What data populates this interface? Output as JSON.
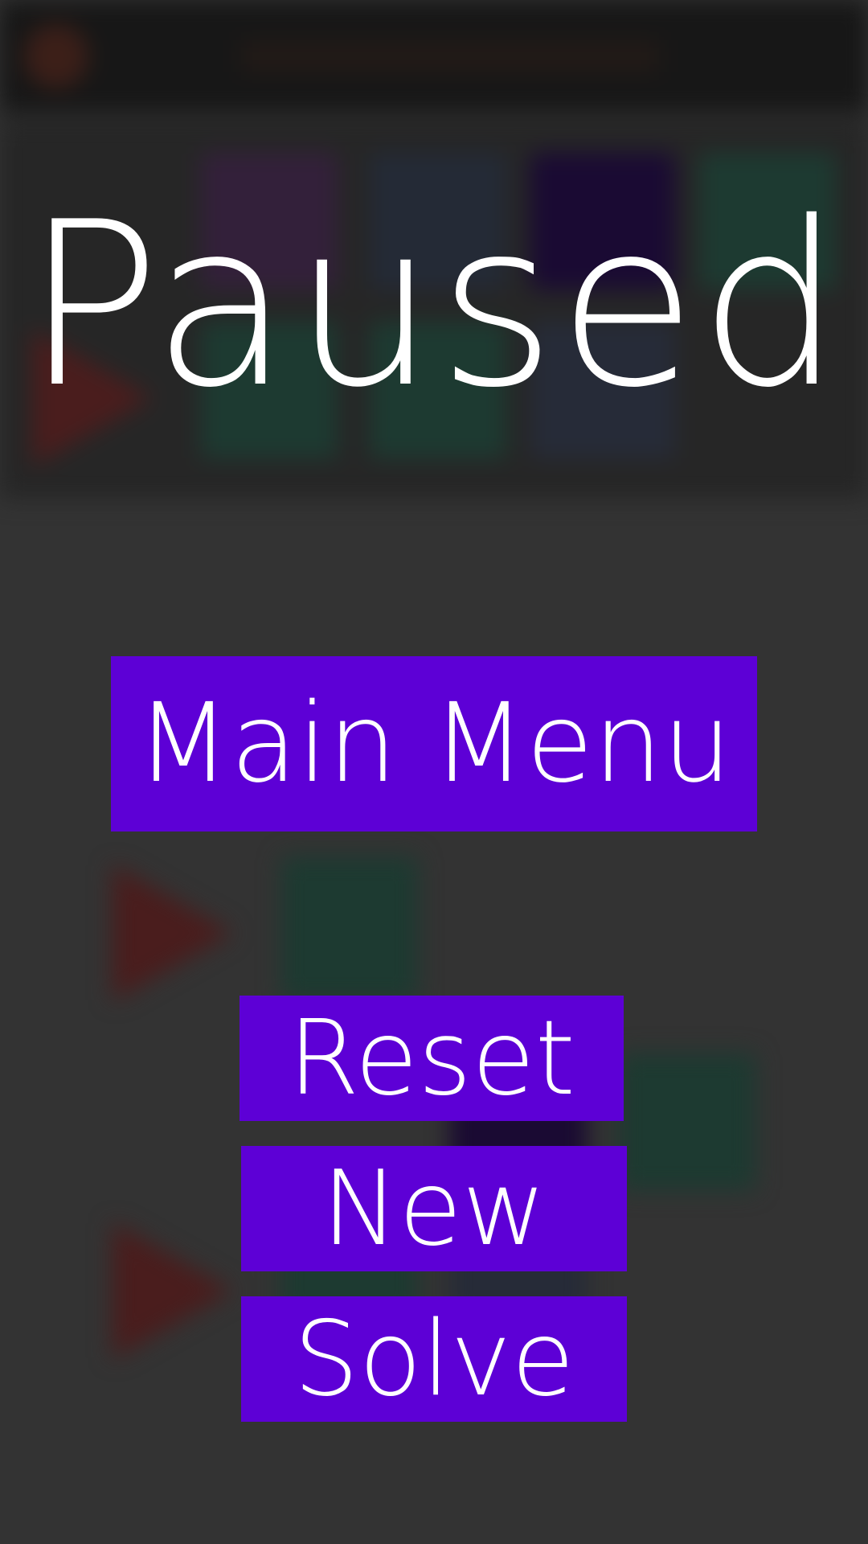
{
  "screen": {
    "title": "Paused"
  },
  "buttons": {
    "main_menu": "Main Menu",
    "reset": "Reset",
    "new": "New",
    "solve": "Solve"
  },
  "colors": {
    "overlay_background": "#333333",
    "button_background": "#5d00d6",
    "text": "#ffffff"
  }
}
